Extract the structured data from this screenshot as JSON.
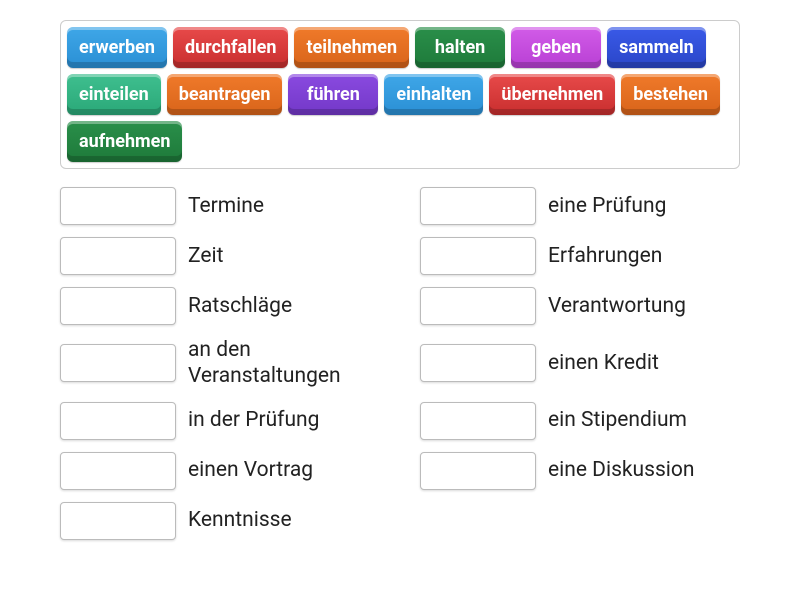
{
  "word_bank": [
    {
      "text": "erwerben",
      "color": "c-lightblue"
    },
    {
      "text": "durchfallen",
      "color": "c-red"
    },
    {
      "text": "teilnehmen",
      "color": "c-orange"
    },
    {
      "text": "halten",
      "color": "c-green"
    },
    {
      "text": "geben",
      "color": "c-magenta"
    },
    {
      "text": "sammeln",
      "color": "c-blue"
    },
    {
      "text": "einteilen",
      "color": "c-teal"
    },
    {
      "text": "beantragen",
      "color": "c-orange"
    },
    {
      "text": "führen",
      "color": "c-purple"
    },
    {
      "text": "einhalten",
      "color": "c-lightblue"
    },
    {
      "text": "übernehmen",
      "color": "c-red"
    },
    {
      "text": "bestehen",
      "color": "c-orange"
    },
    {
      "text": "aufnehmen",
      "color": "c-green"
    }
  ],
  "targets_left": [
    "Termine",
    "Zeit",
    "Ratschläge",
    "an den Veranstaltungen",
    "in der Prüfung",
    "einen Vortrag",
    "Kenntnisse"
  ],
  "targets_right": [
    "eine Prüfung",
    "Erfahrungen",
    "Verantwortung",
    "einen Kredit",
    "ein Stipendium",
    "eine Diskussion"
  ]
}
